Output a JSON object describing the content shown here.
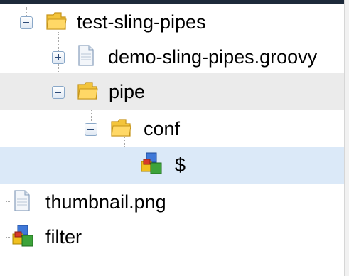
{
  "tree": {
    "nodes": [
      {
        "label": "test-sling-pipes",
        "icon": "folder-icon",
        "expander": "collapse"
      },
      {
        "label": "demo-sling-pipes.groovy",
        "icon": "file-icon",
        "expander": "expand"
      },
      {
        "label": "pipe",
        "icon": "folder-icon",
        "expander": "collapse"
      },
      {
        "label": "conf",
        "icon": "folder-icon",
        "expander": "collapse"
      },
      {
        "label": "$",
        "icon": "node-icon",
        "expander": "none"
      },
      {
        "label": "thumbnail.png",
        "icon": "file-icon",
        "expander": "none"
      },
      {
        "label": "filter",
        "icon": "node-icon",
        "expander": "none"
      }
    ]
  },
  "colors": {
    "selected_row": "#dbe9f8",
    "hover_row": "#ebebeb",
    "folder": "#f2c33d"
  }
}
